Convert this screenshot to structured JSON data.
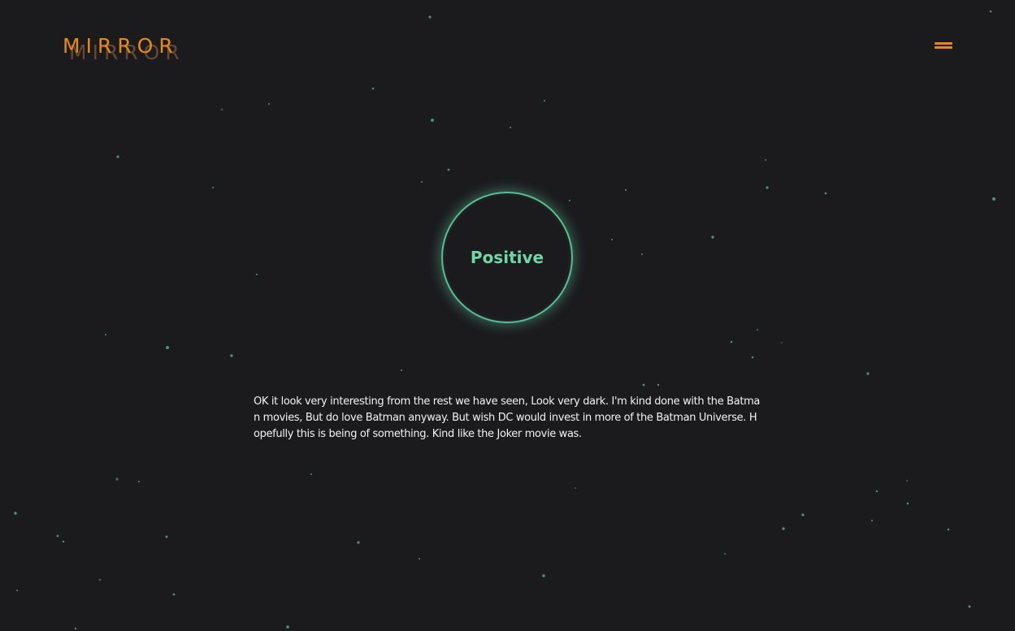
{
  "header": {
    "logo_text": "MIRROR",
    "logo_shadow_text": "MIRROR",
    "menu_icon": "hamburger-menu-icon"
  },
  "result": {
    "sentiment": "Positive"
  },
  "review": {
    "text": "OK it look very interesting from the rest we have seen, Look very dark. I'm kind done with the Batman movies, But do love Batman anyway. But wish DC would invest in more of the Batman Universe. Hopefully this is being of something. Kind like the Joker movie was."
  },
  "colors": {
    "background": "#1b1b1e",
    "accent": "#e5891b",
    "positive": "#6fd7a8",
    "text": "#f2f2f2",
    "star": "#4f8f7c"
  }
}
